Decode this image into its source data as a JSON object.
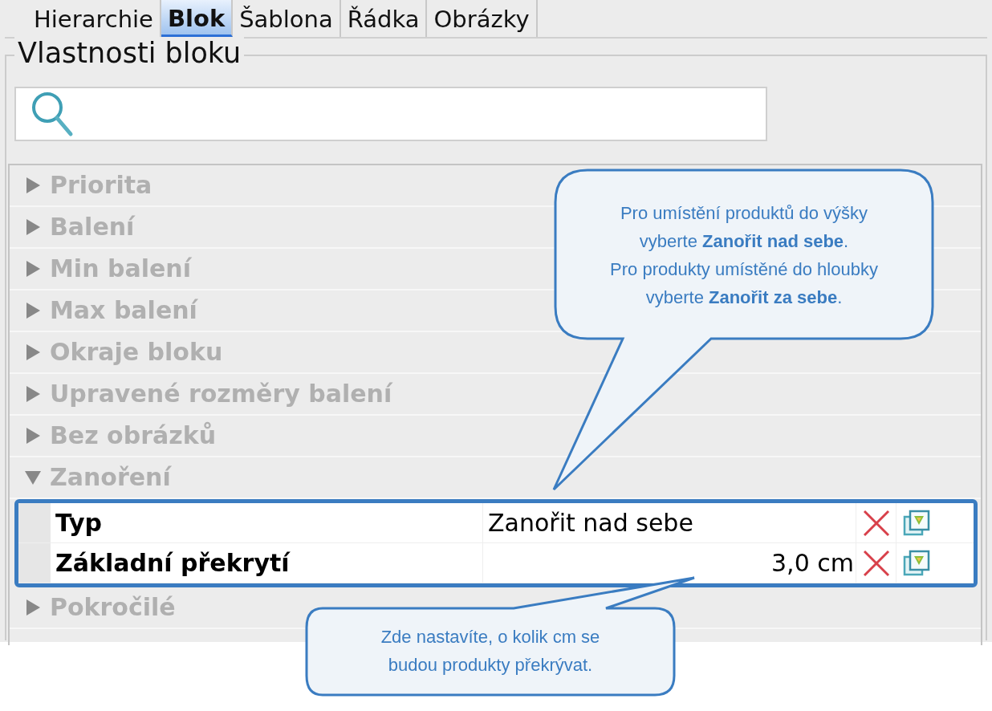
{
  "tabs": [
    {
      "label": "Hierarchie",
      "selected": false
    },
    {
      "label": "Blok",
      "selected": true
    },
    {
      "label": "Šablona",
      "selected": false
    },
    {
      "label": "Řádka",
      "selected": false
    },
    {
      "label": "Obrázky",
      "selected": false
    }
  ],
  "panel": {
    "title": "Vlastnosti bloku"
  },
  "groups": [
    {
      "label": "Priorita",
      "expanded": false
    },
    {
      "label": "Balení",
      "expanded": false
    },
    {
      "label": "Min balení",
      "expanded": false
    },
    {
      "label": "Max balení",
      "expanded": false
    },
    {
      "label": "Okraje bloku",
      "expanded": false
    },
    {
      "label": "Upravené rozměry balení",
      "expanded": false
    },
    {
      "label": "Bez obrázků",
      "expanded": false
    },
    {
      "label": "Zanoření",
      "expanded": true,
      "highlighted": true,
      "properties": [
        {
          "name": "Typ",
          "value": "Zanořit nad sebe",
          "kind": "text"
        },
        {
          "name": "Základní překrytí",
          "value": "3,0 cm",
          "kind": "number"
        }
      ]
    },
    {
      "label": "Pokročilé",
      "expanded": false
    }
  ],
  "callouts": [
    {
      "lines": [
        "Pro umístění produktů do výšky",
        "vyberte **Zanořit nad sebe**.",
        "Pro produkty umístěné do hloubky",
        "vyberte **Zanořit za sebe**."
      ]
    },
    {
      "lines": [
        "Zde nastavíte, o kolik cm se",
        "budou produkty překrývat."
      ]
    }
  ]
}
